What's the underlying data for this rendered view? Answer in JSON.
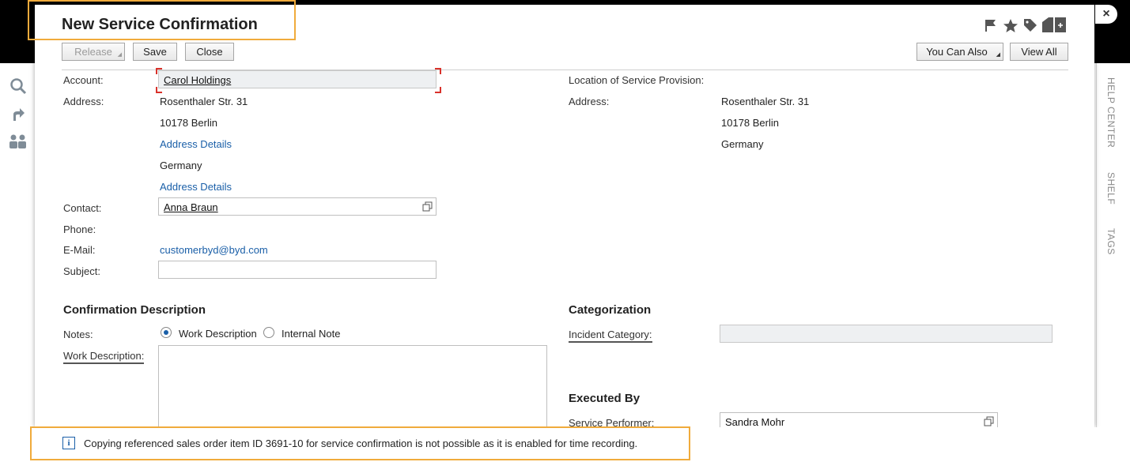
{
  "dialog": {
    "title": "New Service Confirmation",
    "close_glyph": "×"
  },
  "toolbar": {
    "release_label": "Release",
    "save_label": "Save",
    "close_label": "Close",
    "you_can_also_label": "You Can Also",
    "view_all_label": "View All"
  },
  "header_icons": [
    "flag-icon",
    "star-icon",
    "tag-icon",
    "add-tile-icon"
  ],
  "left_rail_icons": [
    "search-icon",
    "share-arrow-icon",
    "users-icon"
  ],
  "right_rail": {
    "help_center": "HELP CENTER",
    "shelf": "SHELF",
    "tags": "TAGS"
  },
  "account_section": {
    "account_label": "Account:",
    "account_value": "Carol Holdings",
    "address_label": "Address:",
    "street": "Rosenthaler Str. 31",
    "city": "10178 Berlin",
    "address_details_link_1": "Address Details",
    "country": "Germany",
    "address_details_link_2": "Address Details",
    "contact_label": "Contact:",
    "contact_value": "Anna Braun",
    "phone_label": "Phone:",
    "email_label": "E-Mail:",
    "email_value": "customerbyd@byd.com",
    "subject_label": "Subject:",
    "subject_value": ""
  },
  "location_section": {
    "title_label": "Location of Service Provision:",
    "address_label": "Address:",
    "street": "Rosenthaler Str. 31",
    "city": "10178 Berlin",
    "country": "Germany"
  },
  "confirmation_description": {
    "heading": "Confirmation Description",
    "notes_label": "Notes:",
    "radio_work_description": "Work Description",
    "radio_internal_note": "Internal Note",
    "selected": "Work Description",
    "work_description_label": "Work Description:",
    "work_description_value": ""
  },
  "categorization": {
    "heading": "Categorization",
    "incident_category_label": "Incident Category:",
    "incident_category_value": ""
  },
  "executed_by": {
    "heading": "Executed By",
    "service_performer_label": "Service Performer:",
    "service_performer_value": "Sandra Mohr"
  },
  "message": {
    "text": "Copying referenced sales order item ID 3691-10 for service confirmation is not possible as it is enabled for time recording.",
    "icon_glyph": "i"
  },
  "colors": {
    "accent_highlight": "#f0ab3c",
    "link": "#1a5fa8",
    "required_marker": "#d9322b"
  }
}
